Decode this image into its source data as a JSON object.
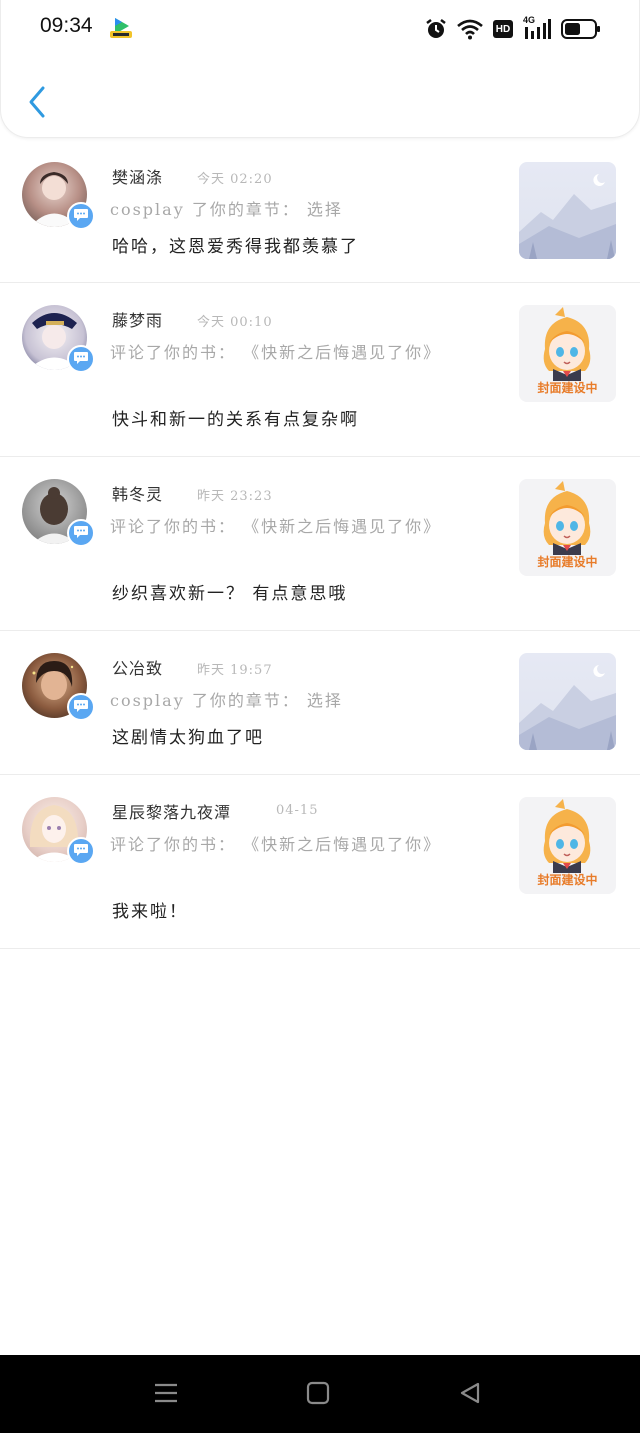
{
  "status_bar": {
    "time": "09:34",
    "app_notification_icon": "video-app-icon",
    "icons": [
      "alarm-icon",
      "wifi-icon",
      "hd-icon",
      "signal-4g-icon",
      "battery-icon"
    ],
    "hd_label": "HD",
    "network_label": "4G"
  },
  "header": {
    "back_icon": "chevron-left-icon",
    "accent_color": "#2f9ae0"
  },
  "notifications": [
    {
      "name": "樊涵涤",
      "time": "今天 02:20",
      "context": "cosplay 了你的章节：  选择",
      "comment": "哈哈，这恩爱秀得我都羡慕了",
      "cover": "landscape",
      "avatar_icon": "user-avatar",
      "badge_icon": "comment-icon"
    },
    {
      "name": "藤梦雨",
      "time": "今天 00:10",
      "context": "评论了你的书：  《快新之后悔遇见了你》",
      "comment": "快斗和新一的关系有点复杂啊",
      "cover": "building",
      "cover_label": "封面建设中",
      "avatar_icon": "user-avatar",
      "badge_icon": "comment-icon"
    },
    {
      "name": "韩冬灵",
      "time": "昨天 23:23",
      "context": "评论了你的书：  《快新之后悔遇见了你》",
      "comment": "纱织喜欢新一？ 有点意思哦",
      "cover": "building",
      "cover_label": "封面建设中",
      "avatar_icon": "user-avatar",
      "badge_icon": "comment-icon"
    },
    {
      "name": "公冶致",
      "time": "昨天 19:57",
      "context": "cosplay 了你的章节：  选择",
      "comment": "这剧情太狗血了吧",
      "cover": "landscape",
      "avatar_icon": "user-avatar",
      "badge_icon": "comment-icon"
    },
    {
      "name": "星辰黎落九夜潭",
      "time": "04-15",
      "context": "评论了你的书：  《快新之后悔遇见了你》",
      "comment": "我来啦！",
      "cover": "building",
      "cover_label": "封面建设中",
      "avatar_icon": "user-avatar",
      "badge_icon": "comment-icon"
    }
  ],
  "navbar": {
    "buttons": [
      "menu-icon",
      "home-square-icon",
      "back-triangle-icon"
    ]
  }
}
